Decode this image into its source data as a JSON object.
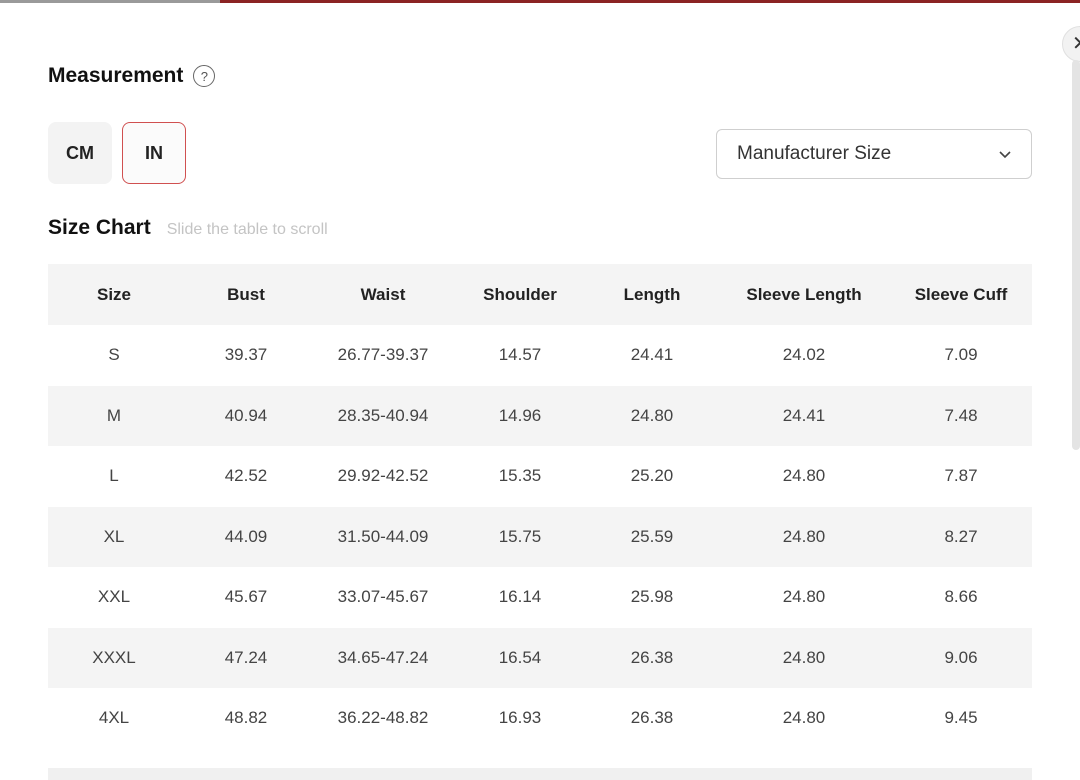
{
  "measurement": {
    "title": "Measurement",
    "help_icon": "question-circle-icon",
    "units": [
      "CM",
      "IN"
    ],
    "selected_unit": "IN"
  },
  "size_type_select": {
    "value": "Manufacturer Size",
    "icon": "chevron-down-icon"
  },
  "size_chart": {
    "title": "Size Chart",
    "hint": "Slide the table to scroll",
    "columns": [
      "Size",
      "Bust",
      "Waist",
      "Shoulder",
      "Length",
      "Sleeve Length",
      "Sleeve Cuff"
    ],
    "rows": [
      [
        "S",
        "39.37",
        "26.77-39.37",
        "14.57",
        "24.41",
        "24.02",
        "7.09"
      ],
      [
        "M",
        "40.94",
        "28.35-40.94",
        "14.96",
        "24.80",
        "24.41",
        "7.48"
      ],
      [
        "L",
        "42.52",
        "29.92-42.52",
        "15.35",
        "25.20",
        "24.80",
        "7.87"
      ],
      [
        "XL",
        "44.09",
        "31.50-44.09",
        "15.75",
        "25.59",
        "24.80",
        "8.27"
      ],
      [
        "XXL",
        "45.67",
        "33.07-45.67",
        "16.14",
        "25.98",
        "24.80",
        "8.66"
      ],
      [
        "XXXL",
        "47.24",
        "34.65-47.24",
        "16.54",
        "26.38",
        "24.80",
        "9.06"
      ],
      [
        "4XL",
        "48.82",
        "36.22-48.82",
        "16.93",
        "26.38",
        "24.80",
        "9.45"
      ]
    ]
  },
  "close_icon": "close-icon",
  "colors": {
    "accent": "#d05050",
    "top_bar": "#8b2323",
    "stripe": "#f4f4f4"
  }
}
